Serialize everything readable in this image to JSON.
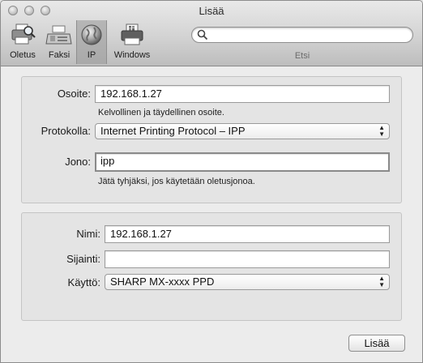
{
  "window": {
    "title": "Lisää"
  },
  "toolbar": {
    "tools": [
      {
        "label": "Oletus",
        "icon": "printer-magnifier-icon"
      },
      {
        "label": "Faksi",
        "icon": "fax-icon"
      },
      {
        "label": "IP",
        "icon": "globe-icon",
        "selected": true
      },
      {
        "label": "Windows",
        "icon": "windows-printer-icon"
      }
    ],
    "search": {
      "placeholder": "",
      "value": "",
      "label": "Etsi"
    }
  },
  "ip_group": {
    "address_label": "Osoite:",
    "address_value": "192.168.1.27",
    "address_hint": "Kelvollinen ja täydellinen osoite.",
    "protocol_label": "Protokolla:",
    "protocol_value": "Internet Printing Protocol – IPP",
    "queue_label": "Jono:",
    "queue_value": "ipp",
    "queue_hint": "Jätä tyhjäksi, jos käytetään oletusjonoa."
  },
  "printer_group": {
    "name_label": "Nimi:",
    "name_value": "192.168.1.27",
    "location_label": "Sijainti:",
    "location_value": "",
    "use_label": "Käyttö:",
    "use_value": "SHARP MX-xxxx PPD"
  },
  "footer": {
    "add_button": "Lisää"
  }
}
